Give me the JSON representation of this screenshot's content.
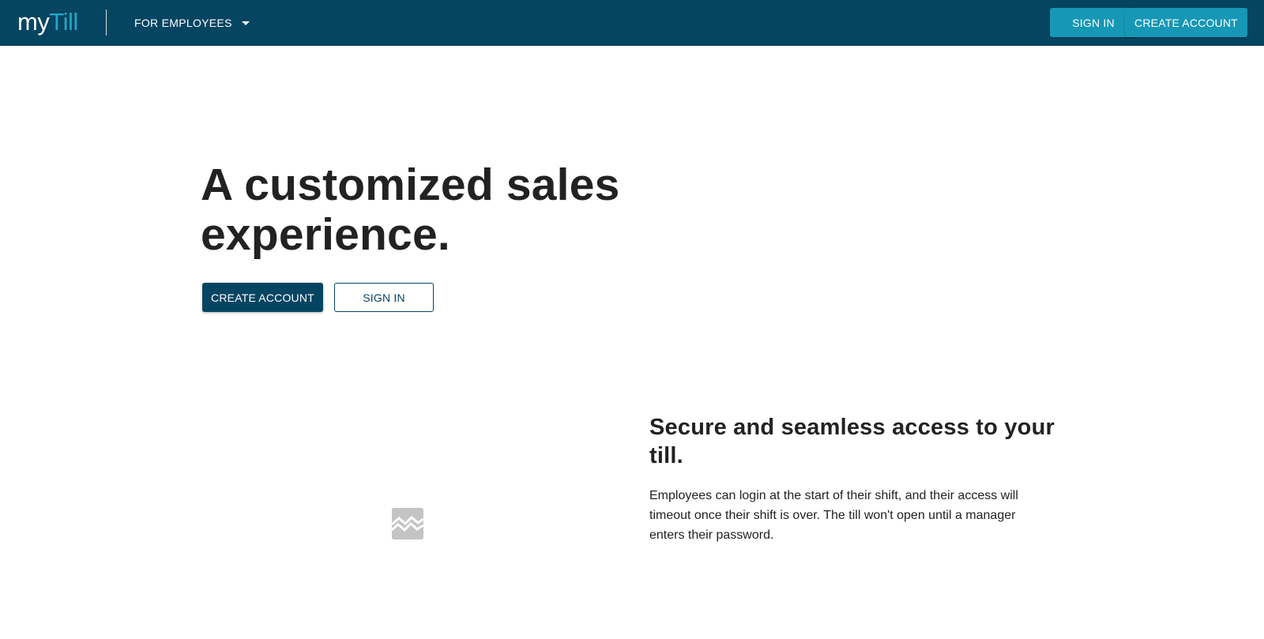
{
  "header": {
    "logo_my": "my",
    "logo_till": "Till",
    "menu_label": "FOR EMPLOYEES",
    "signin_label": "SIGN IN",
    "create_label": "CREATE ACCOUNT"
  },
  "hero": {
    "title_line1": "A customized sales",
    "title_line2": "experience.",
    "create_label": "CREATE ACCOUNT",
    "signin_label": "SIGN IN"
  },
  "feature": {
    "title": "Secure and seamless access to your till.",
    "body": "Employees can login at the start of their shift, and their access will timeout once their shift is over. The till won't open until a manager enters their password.",
    "image_icon": "broken-image-icon"
  },
  "colors": {
    "navbar": "#064562",
    "accent": "#1697b6",
    "logo_accent": "#24a5c4",
    "primary_button": "#064562",
    "text": "#222222"
  }
}
